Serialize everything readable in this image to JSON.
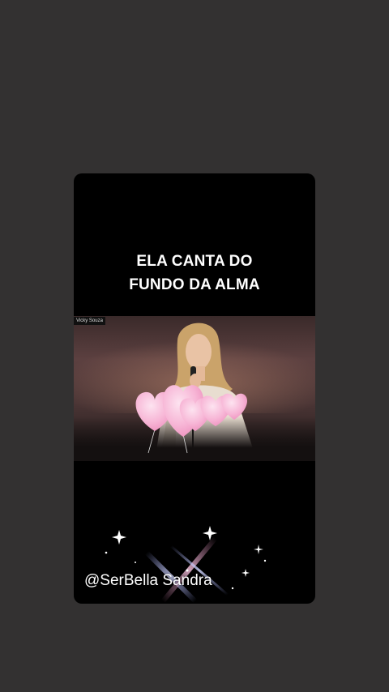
{
  "story": {
    "headline_line1": "ELA CANTA DO",
    "headline_line2": "FUNDO DA ALMA",
    "video_watermark": "Vicky Souza",
    "handle": "@SerBella Sandra"
  },
  "colors": {
    "background": "#333131",
    "card": "#000000",
    "text": "#ffffff",
    "heart": "#f7b6d6"
  },
  "icons": [
    "heart-balloon-icon",
    "sparkle-icon"
  ]
}
